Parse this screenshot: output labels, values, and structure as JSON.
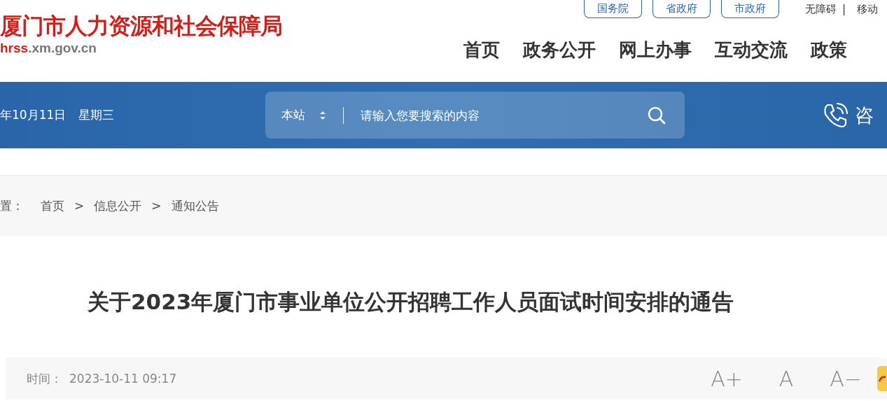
{
  "header": {
    "logo_title": "厦门市人力资源和社会保障局",
    "logo_domain_highlight": "hrss",
    "logo_domain_rest": ".xm.gov.cn",
    "top_links": [
      {
        "label": "国务院",
        "kind": "button"
      },
      {
        "label": "省政府",
        "kind": "button"
      },
      {
        "label": "市政府",
        "kind": "button"
      },
      {
        "label": "无障碍",
        "kind": "link"
      },
      {
        "label": "|",
        "kind": "separator"
      },
      {
        "label": "移动",
        "kind": "link"
      }
    ],
    "nav": [
      "首页",
      "政务公开",
      "网上办事",
      "互动交流",
      "政策"
    ]
  },
  "banner": {
    "date": "年10月11日",
    "weekday": "星期三",
    "search": {
      "scope": "本站",
      "placeholder": "请输入您要搜索的内容"
    },
    "consult": "咨"
  },
  "breadcrumb": {
    "label": "置：",
    "items": [
      "首页",
      "信息公开",
      "通知公告"
    ],
    "separator": ">"
  },
  "article": {
    "title": "关于2023年厦门市事业单位公开招聘工作人员面试时间安排的通告",
    "time_label": "时间：",
    "time": "2023-10-11 09:17",
    "font_sizes": [
      "A+",
      "A",
      "A−"
    ]
  }
}
